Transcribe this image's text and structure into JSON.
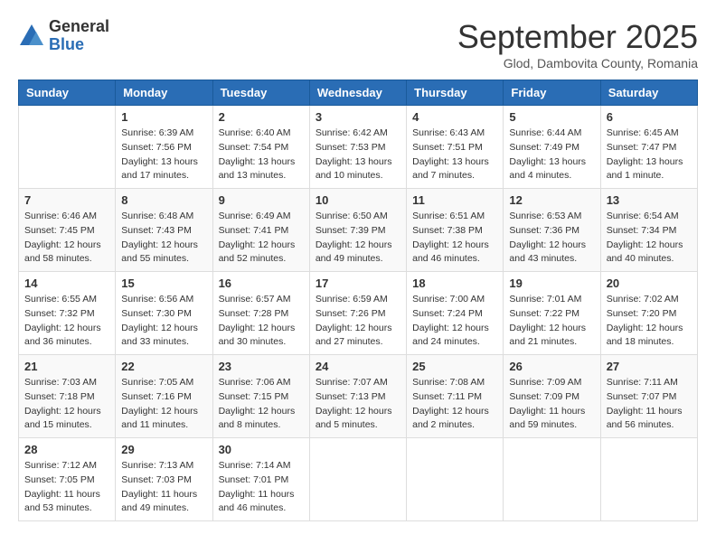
{
  "logo": {
    "general": "General",
    "blue": "Blue"
  },
  "title": "September 2025",
  "location": "Glod, Dambovita County, Romania",
  "days_of_week": [
    "Sunday",
    "Monday",
    "Tuesday",
    "Wednesday",
    "Thursday",
    "Friday",
    "Saturday"
  ],
  "weeks": [
    [
      {
        "day": "",
        "sunrise": "",
        "sunset": "",
        "daylight": ""
      },
      {
        "day": "1",
        "sunrise": "Sunrise: 6:39 AM",
        "sunset": "Sunset: 7:56 PM",
        "daylight": "Daylight: 13 hours and 17 minutes."
      },
      {
        "day": "2",
        "sunrise": "Sunrise: 6:40 AM",
        "sunset": "Sunset: 7:54 PM",
        "daylight": "Daylight: 13 hours and 13 minutes."
      },
      {
        "day": "3",
        "sunrise": "Sunrise: 6:42 AM",
        "sunset": "Sunset: 7:53 PM",
        "daylight": "Daylight: 13 hours and 10 minutes."
      },
      {
        "day": "4",
        "sunrise": "Sunrise: 6:43 AM",
        "sunset": "Sunset: 7:51 PM",
        "daylight": "Daylight: 13 hours and 7 minutes."
      },
      {
        "day": "5",
        "sunrise": "Sunrise: 6:44 AM",
        "sunset": "Sunset: 7:49 PM",
        "daylight": "Daylight: 13 hours and 4 minutes."
      },
      {
        "day": "6",
        "sunrise": "Sunrise: 6:45 AM",
        "sunset": "Sunset: 7:47 PM",
        "daylight": "Daylight: 13 hours and 1 minute."
      }
    ],
    [
      {
        "day": "7",
        "sunrise": "Sunrise: 6:46 AM",
        "sunset": "Sunset: 7:45 PM",
        "daylight": "Daylight: 12 hours and 58 minutes."
      },
      {
        "day": "8",
        "sunrise": "Sunrise: 6:48 AM",
        "sunset": "Sunset: 7:43 PM",
        "daylight": "Daylight: 12 hours and 55 minutes."
      },
      {
        "day": "9",
        "sunrise": "Sunrise: 6:49 AM",
        "sunset": "Sunset: 7:41 PM",
        "daylight": "Daylight: 12 hours and 52 minutes."
      },
      {
        "day": "10",
        "sunrise": "Sunrise: 6:50 AM",
        "sunset": "Sunset: 7:39 PM",
        "daylight": "Daylight: 12 hours and 49 minutes."
      },
      {
        "day": "11",
        "sunrise": "Sunrise: 6:51 AM",
        "sunset": "Sunset: 7:38 PM",
        "daylight": "Daylight: 12 hours and 46 minutes."
      },
      {
        "day": "12",
        "sunrise": "Sunrise: 6:53 AM",
        "sunset": "Sunset: 7:36 PM",
        "daylight": "Daylight: 12 hours and 43 minutes."
      },
      {
        "day": "13",
        "sunrise": "Sunrise: 6:54 AM",
        "sunset": "Sunset: 7:34 PM",
        "daylight": "Daylight: 12 hours and 40 minutes."
      }
    ],
    [
      {
        "day": "14",
        "sunrise": "Sunrise: 6:55 AM",
        "sunset": "Sunset: 7:32 PM",
        "daylight": "Daylight: 12 hours and 36 minutes."
      },
      {
        "day": "15",
        "sunrise": "Sunrise: 6:56 AM",
        "sunset": "Sunset: 7:30 PM",
        "daylight": "Daylight: 12 hours and 33 minutes."
      },
      {
        "day": "16",
        "sunrise": "Sunrise: 6:57 AM",
        "sunset": "Sunset: 7:28 PM",
        "daylight": "Daylight: 12 hours and 30 minutes."
      },
      {
        "day": "17",
        "sunrise": "Sunrise: 6:59 AM",
        "sunset": "Sunset: 7:26 PM",
        "daylight": "Daylight: 12 hours and 27 minutes."
      },
      {
        "day": "18",
        "sunrise": "Sunrise: 7:00 AM",
        "sunset": "Sunset: 7:24 PM",
        "daylight": "Daylight: 12 hours and 24 minutes."
      },
      {
        "day": "19",
        "sunrise": "Sunrise: 7:01 AM",
        "sunset": "Sunset: 7:22 PM",
        "daylight": "Daylight: 12 hours and 21 minutes."
      },
      {
        "day": "20",
        "sunrise": "Sunrise: 7:02 AM",
        "sunset": "Sunset: 7:20 PM",
        "daylight": "Daylight: 12 hours and 18 minutes."
      }
    ],
    [
      {
        "day": "21",
        "sunrise": "Sunrise: 7:03 AM",
        "sunset": "Sunset: 7:18 PM",
        "daylight": "Daylight: 12 hours and 15 minutes."
      },
      {
        "day": "22",
        "sunrise": "Sunrise: 7:05 AM",
        "sunset": "Sunset: 7:16 PM",
        "daylight": "Daylight: 12 hours and 11 minutes."
      },
      {
        "day": "23",
        "sunrise": "Sunrise: 7:06 AM",
        "sunset": "Sunset: 7:15 PM",
        "daylight": "Daylight: 12 hours and 8 minutes."
      },
      {
        "day": "24",
        "sunrise": "Sunrise: 7:07 AM",
        "sunset": "Sunset: 7:13 PM",
        "daylight": "Daylight: 12 hours and 5 minutes."
      },
      {
        "day": "25",
        "sunrise": "Sunrise: 7:08 AM",
        "sunset": "Sunset: 7:11 PM",
        "daylight": "Daylight: 12 hours and 2 minutes."
      },
      {
        "day": "26",
        "sunrise": "Sunrise: 7:09 AM",
        "sunset": "Sunset: 7:09 PM",
        "daylight": "Daylight: 11 hours and 59 minutes."
      },
      {
        "day": "27",
        "sunrise": "Sunrise: 7:11 AM",
        "sunset": "Sunset: 7:07 PM",
        "daylight": "Daylight: 11 hours and 56 minutes."
      }
    ],
    [
      {
        "day": "28",
        "sunrise": "Sunrise: 7:12 AM",
        "sunset": "Sunset: 7:05 PM",
        "daylight": "Daylight: 11 hours and 53 minutes."
      },
      {
        "day": "29",
        "sunrise": "Sunrise: 7:13 AM",
        "sunset": "Sunset: 7:03 PM",
        "daylight": "Daylight: 11 hours and 49 minutes."
      },
      {
        "day": "30",
        "sunrise": "Sunrise: 7:14 AM",
        "sunset": "Sunset: 7:01 PM",
        "daylight": "Daylight: 11 hours and 46 minutes."
      },
      {
        "day": "",
        "sunrise": "",
        "sunset": "",
        "daylight": ""
      },
      {
        "day": "",
        "sunrise": "",
        "sunset": "",
        "daylight": ""
      },
      {
        "day": "",
        "sunrise": "",
        "sunset": "",
        "daylight": ""
      },
      {
        "day": "",
        "sunrise": "",
        "sunset": "",
        "daylight": ""
      }
    ]
  ]
}
